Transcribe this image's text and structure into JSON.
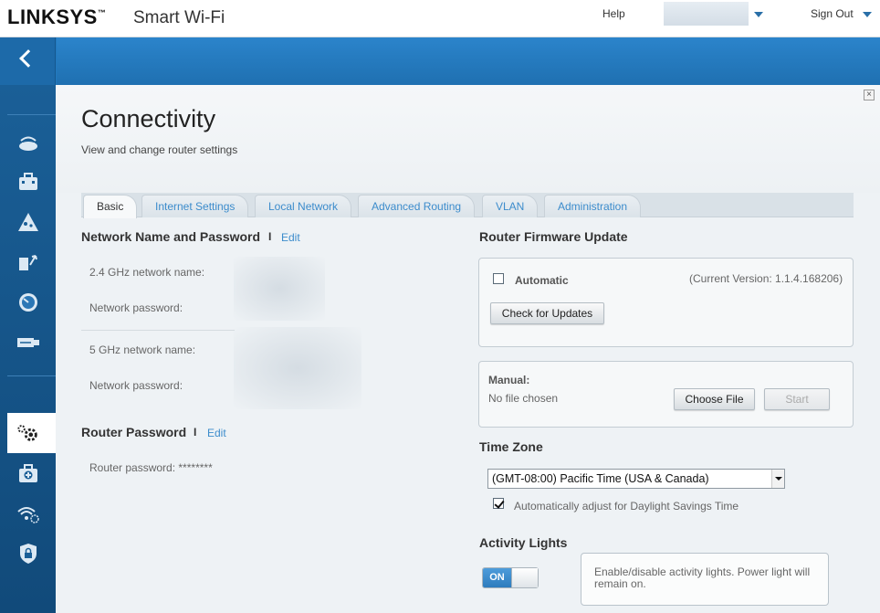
{
  "header": {
    "brand": "LINKSYS",
    "brand_tm": "™",
    "product": "Smart Wi-Fi",
    "help": "Help",
    "sign_out": "Sign Out"
  },
  "sidebar": {
    "items": [
      {
        "icon": "router-icon"
      },
      {
        "icon": "toolbox-icon"
      },
      {
        "icon": "parental-controls-icon"
      },
      {
        "icon": "media-prioritization-icon"
      },
      {
        "icon": "speed-test-icon"
      },
      {
        "icon": "usb-storage-icon"
      },
      {
        "icon": "connectivity-gears-icon",
        "active": true
      },
      {
        "icon": "troubleshooting-icon"
      },
      {
        "icon": "wireless-icon"
      },
      {
        "icon": "security-icon"
      }
    ]
  },
  "page": {
    "title": "Connectivity",
    "subtitle": "View and change router settings",
    "close": "×"
  },
  "tabs": [
    {
      "label": "Basic",
      "active": true
    },
    {
      "label": "Internet Settings"
    },
    {
      "label": "Local Network"
    },
    {
      "label": "Advanced Routing"
    },
    {
      "label": "VLAN"
    },
    {
      "label": "Administration"
    }
  ],
  "network": {
    "title": "Network Name and Password",
    "separator": "I",
    "edit": "Edit",
    "ghz24_name_label": "2.4 GHz network name:",
    "ghz24_pw_label": "Network password:",
    "ghz5_name_label": "5 GHz network name:",
    "ghz5_pw_label": "Network password:"
  },
  "router_password": {
    "title": "Router Password",
    "separator": "I",
    "edit": "Edit",
    "label": "Router password:",
    "value": "********"
  },
  "firmware": {
    "title": "Router Firmware Update",
    "automatic_label": "Automatic",
    "automatic_checked": false,
    "current_version": "(Current Version: 1.1.4.168206)",
    "check_button": "Check for Updates",
    "manual_label": "Manual:",
    "no_file": "No file chosen",
    "choose_file": "Choose File",
    "start": "Start"
  },
  "time_zone": {
    "title": "Time Zone",
    "selected": "(GMT-08:00) Pacific Time (USA & Canada)",
    "dst_label": "Automatically adjust for Daylight Savings Time",
    "dst_checked": true
  },
  "activity_lights": {
    "title": "Activity Lights",
    "toggle_label": "ON",
    "state": "on",
    "description": "Enable/disable activity lights. Power light will remain on."
  },
  "colors": {
    "accent_blue": "#2279bf",
    "link_blue": "#3c8ccc",
    "sidebar_blue": "#1b66a3"
  }
}
